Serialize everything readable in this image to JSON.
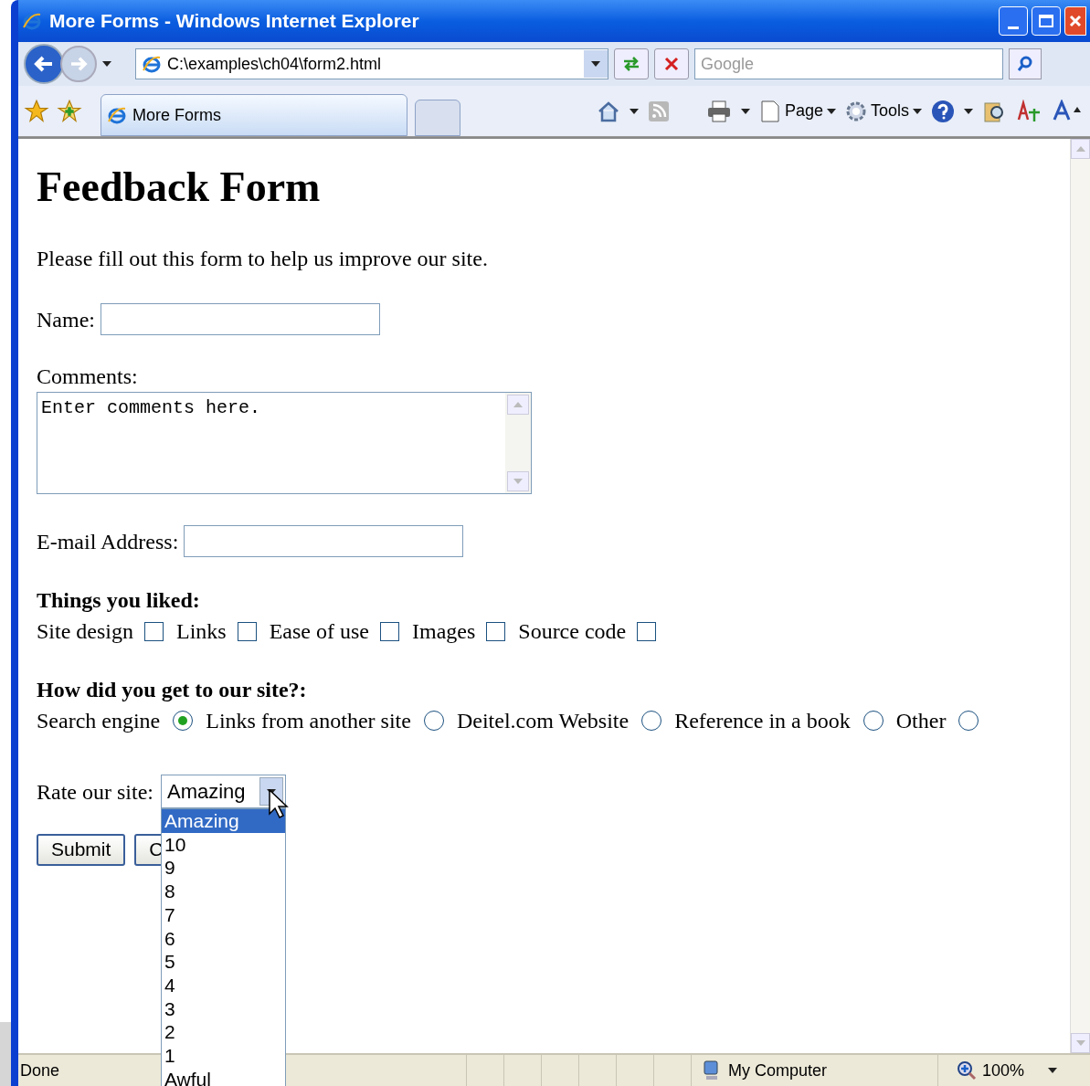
{
  "window": {
    "title": "More Forms - Windows Internet Explorer"
  },
  "address_bar": {
    "value": "C:\\examples\\ch04\\form2.html"
  },
  "search": {
    "placeholder": "Google"
  },
  "tabs": [
    {
      "label": "More Forms",
      "selected": true
    }
  ],
  "toolbar": {
    "page_label": "Page",
    "tools_label": "Tools"
  },
  "page": {
    "heading": "Feedback Form",
    "intro": "Please fill out this form to help us improve our site.",
    "name_label": "Name:",
    "comments_label": "Comments:",
    "comments_value": "Enter comments here.",
    "email_label": "E-mail Address:",
    "liked_heading": "Things you liked:",
    "liked": [
      {
        "label": "Site design",
        "checked": false
      },
      {
        "label": "Links",
        "checked": false
      },
      {
        "label": "Ease of use",
        "checked": false
      },
      {
        "label": "Images",
        "checked": false
      },
      {
        "label": "Source code",
        "checked": false
      }
    ],
    "source_heading": "How did you get to our site?:",
    "sources": [
      {
        "label": "Search engine",
        "selected": true
      },
      {
        "label": "Links from another site",
        "selected": false
      },
      {
        "label": "Deitel.com Website",
        "selected": false
      },
      {
        "label": "Reference in a book",
        "selected": false
      },
      {
        "label": "Other",
        "selected": false
      }
    ],
    "rate_label": "Rate our site:",
    "rate_value": "Amazing",
    "rate_options": [
      {
        "label": "Amazing",
        "selected": true
      },
      {
        "label": "10",
        "selected": false
      },
      {
        "label": "9",
        "selected": false
      },
      {
        "label": "8",
        "selected": false
      },
      {
        "label": "7",
        "selected": false
      },
      {
        "label": "6",
        "selected": false
      },
      {
        "label": "5",
        "selected": false
      },
      {
        "label": "4",
        "selected": false
      },
      {
        "label": "3",
        "selected": false
      },
      {
        "label": "2",
        "selected": false
      },
      {
        "label": "1",
        "selected": false
      },
      {
        "label": "Awful",
        "selected": false
      }
    ],
    "buttons": [
      "Submit",
      "C"
    ]
  },
  "status_bar": {
    "text": "Done",
    "zone": "My Computer",
    "zoom": "100%"
  }
}
